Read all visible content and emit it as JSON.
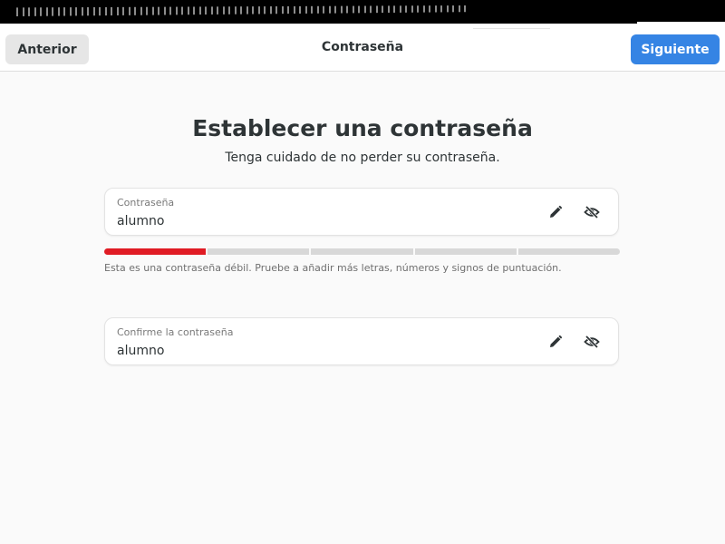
{
  "window": {
    "title": "Contraseña"
  },
  "header": {
    "back_label": "Anterior",
    "next_label": "Siguiente",
    "accent_color": "#3584e4"
  },
  "main": {
    "heading": "Establecer una contraseña",
    "subheading": "Tenga cuidado de no perder su contraseña.",
    "password": {
      "label": "Contraseña",
      "value": "alumno",
      "edit_icon": "pencil-icon",
      "reveal_icon": "eye-slash-icon"
    },
    "strength": {
      "level": 1,
      "max": 5,
      "color": "#e01b24",
      "hint": "Esta es una contraseña débil. Pruebe a añadir más letras, números y signos de puntuación."
    },
    "confirm": {
      "label": "Confirme la contraseña",
      "value": "alumno",
      "edit_icon": "pencil-icon",
      "reveal_icon": "eye-slash-icon"
    }
  }
}
